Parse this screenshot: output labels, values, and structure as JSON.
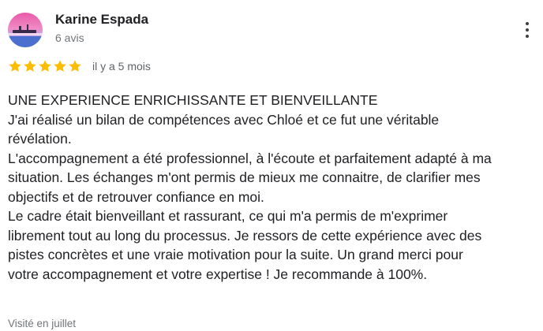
{
  "review": {
    "author": {
      "name": "Karine Espada",
      "review_count": "6 avis",
      "avatar_icon": "profile-photo"
    },
    "menu_icon": "more-vert-icon",
    "rating": 5,
    "rating_max": 5,
    "star_color": "#fbbc04",
    "date": "il y a 5 mois",
    "lines": [
      "UNE EXPERIENCE ENRICHISSANTE ET BIENVEILLANTE",
      "J'ai réalisé un bilan de compétences avec Chloé et ce fut une véritable",
      "révélation.",
      "L'accompagnement a été professionnel, à l'écoute et parfaitement adapté à ma",
      "situation. Les échanges m'ont permis de mieux me connaitre, de clarifier mes",
      "objectifs et de retrouver confiance en moi.",
      "Le cadre était bienveillant et rassurant, ce qui m'a permis de m'exprimer",
      "librement tout au long du processus. Je ressors de cette expérience avec des",
      "pistes concrètes et une vraie motivation pour la suite. Un grand merci pour",
      "votre accompagnement et votre expertise ! Je recommande à 100%."
    ],
    "visit": "Visité en juillet"
  }
}
